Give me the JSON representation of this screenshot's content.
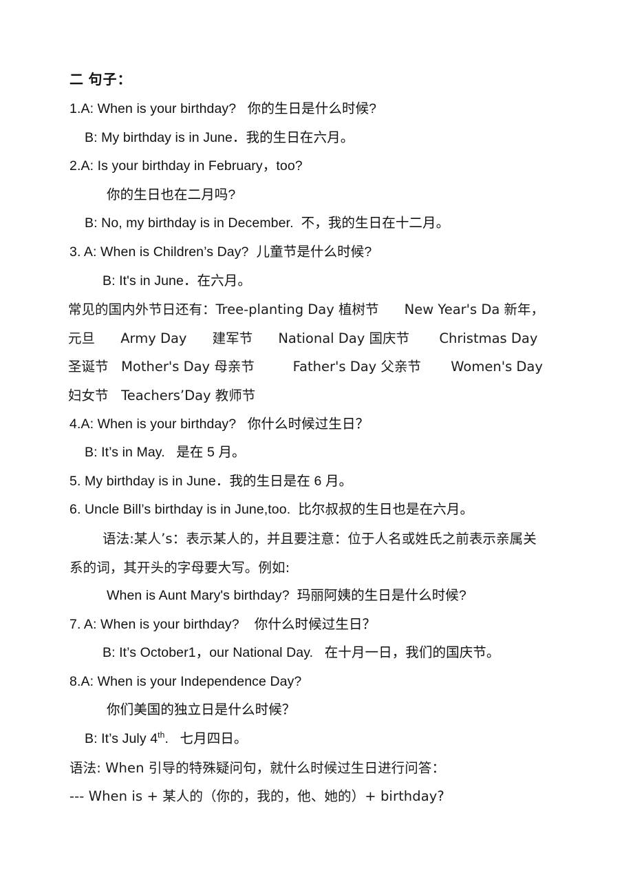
{
  "document": {
    "heading": "二 句子：",
    "sentences": [
      {
        "id": "s1-a",
        "indent": 0,
        "text": "1.A: When is your birthday?   你的生日是什么时候?"
      },
      {
        "id": "s1-b",
        "indent": 1,
        "text": "B: My birthday is in June．我的生日在六月。"
      },
      {
        "id": "s2-a",
        "indent": 0,
        "text": "2.A: Is your birthday in February，too?"
      },
      {
        "id": "s2-a-cn",
        "indent": 3,
        "text": "你的生日也在二月吗?"
      },
      {
        "id": "s2-b",
        "indent": 1,
        "text": "B: No, my birthday is in December.  不，我的生日在十二月。"
      },
      {
        "id": "s3-a",
        "indent": 0,
        "text": "3. A: When is Children’s Day?  儿童节是什么时候?"
      },
      {
        "id": "s3-b",
        "indent": 2,
        "text": "B: It's in June．在六月。"
      }
    ],
    "festival_intro_label": "常见的国内外节日还有：",
    "festival_rows": [
      "常见的国内外节日还有：Tree-planting Day 植树节      New Year's Da 新年，",
      "元旦      Army Day      建军节      National Day 国庆节       Christmas Day",
      "圣诞节   Mother's Day 母亲节         Father's Day 父亲节       Women's Day",
      "妇女节   Teachers’Day 教师节"
    ],
    "festivals": [
      {
        "en": "Tree-planting Day",
        "cn": "植树节"
      },
      {
        "en": "New Year's Da",
        "cn": "新年，元旦"
      },
      {
        "en": "Army Day",
        "cn": "建军节"
      },
      {
        "en": "National Day",
        "cn": "国庆节"
      },
      {
        "en": "Christmas Day",
        "cn": "圣诞节"
      },
      {
        "en": "Mother's Day",
        "cn": "母亲节"
      },
      {
        "en": "Father's Day",
        "cn": "父亲节"
      },
      {
        "en": "Women's Day",
        "cn": "妇女节"
      },
      {
        "en": "Teachers’Day",
        "cn": "教师节"
      }
    ],
    "sentences2": [
      {
        "id": "s4-a",
        "indent": 0,
        "text": "4.A: When is your birthday?   你什么时候过生日？"
      },
      {
        "id": "s4-b",
        "indent": 1,
        "text": "B: It’s in May.   是在 5 月。"
      },
      {
        "id": "s5",
        "indent": 0,
        "text": "5. My birthday is in June．我的生日是在 6 月。"
      },
      {
        "id": "s6",
        "indent": 0,
        "text": "6. Uncle Bill’s birthday is in June,too.  比尔叔叔的生日也是在六月。"
      }
    ],
    "grammar_note_1": {
      "line1": "语法:某人’s：表示某人的，并且要注意：位于人名或姓氏之前表示亲属关",
      "line2": "系的词，其开头的字母要大写。例如:",
      "example": "When is Aunt Mary's birthday?  玛丽阿姨的生日是什么时候?"
    },
    "sentences3": [
      {
        "id": "s7-a",
        "indent": 0,
        "text": "7. A: When is your birthday?    你什么时候过生日？"
      },
      {
        "id": "s7-b",
        "indent": 2,
        "text": "B: It’s October1，our National Day.   在十月一日，我们的国庆节。"
      },
      {
        "id": "s8-a",
        "indent": 0,
        "text": "8.A: When is your Independence Day?"
      },
      {
        "id": "s8-a-cn",
        "indent": 3,
        "text": "你们美国的独立日是什么时候？"
      }
    ],
    "sentence_8b": {
      "indent": 1,
      "prefix": "B: It’s July 4",
      "superscript": "th",
      "suffix": ".   七月四日。"
    },
    "grammar_note_2": {
      "line1": "语法: When 引导的特殊疑问句，就什么时候过生日进行问答：",
      "line2": "--- When is + 某人的（你的，我的，他、她的）+ birthday?"
    }
  }
}
